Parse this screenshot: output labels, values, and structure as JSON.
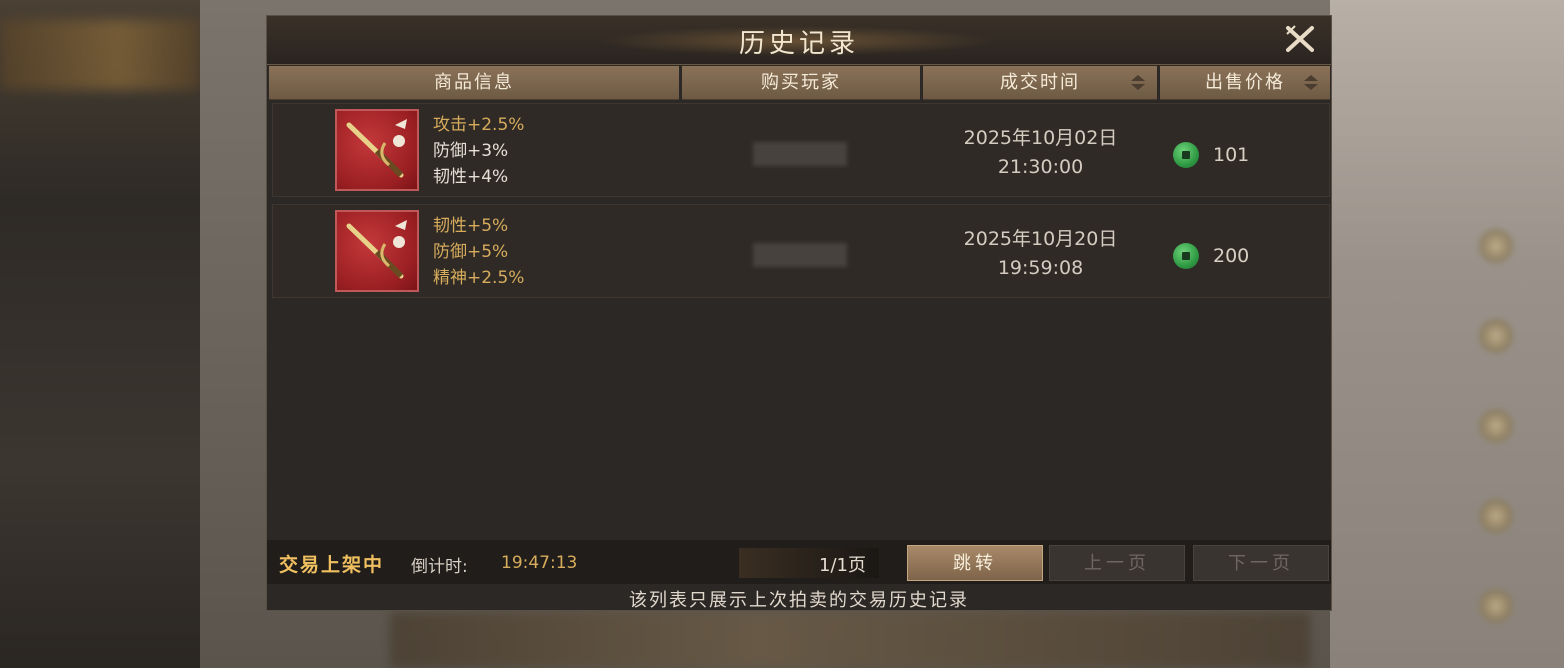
{
  "dialog": {
    "title": "历史记录",
    "close_icon": "close-icon"
  },
  "table": {
    "headers": {
      "item_info": "商品信息",
      "buyer": "购买玩家",
      "deal_time": "成交时间",
      "sale_price": "出售价格"
    },
    "rows": [
      {
        "item_icon": "dagger-item-icon",
        "attrs": [
          {
            "text": "攻击+2.5%",
            "color": "#d7ac5c"
          },
          {
            "text": "防御+3%",
            "color": "#e6e0d6"
          },
          {
            "text": "韧性+4%",
            "color": "#e6e0d6"
          }
        ],
        "date": "2025年10月02日",
        "time": "21:30:00",
        "currency_icon": "jade-coin-icon",
        "price": "101"
      },
      {
        "item_icon": "dagger-item-icon",
        "attrs": [
          {
            "text": "韧性+5%",
            "color": "#d7ac5c"
          },
          {
            "text": "防御+5%",
            "color": "#d7ac5c"
          },
          {
            "text": "精神+2.5%",
            "color": "#d7ac5c"
          }
        ],
        "date": "2025年10月20日",
        "time": "19:59:08",
        "currency_icon": "jade-coin-icon",
        "price": "200"
      }
    ]
  },
  "footer": {
    "trade_status": "交易上架中",
    "countdown_label": "倒计时:",
    "countdown": "19:47:13",
    "page": "1/1页",
    "jump_button": "跳转",
    "prev_button": "上一页",
    "next_button": "下一页",
    "notice": "该列表只展示上次拍卖的交易历史记录"
  }
}
